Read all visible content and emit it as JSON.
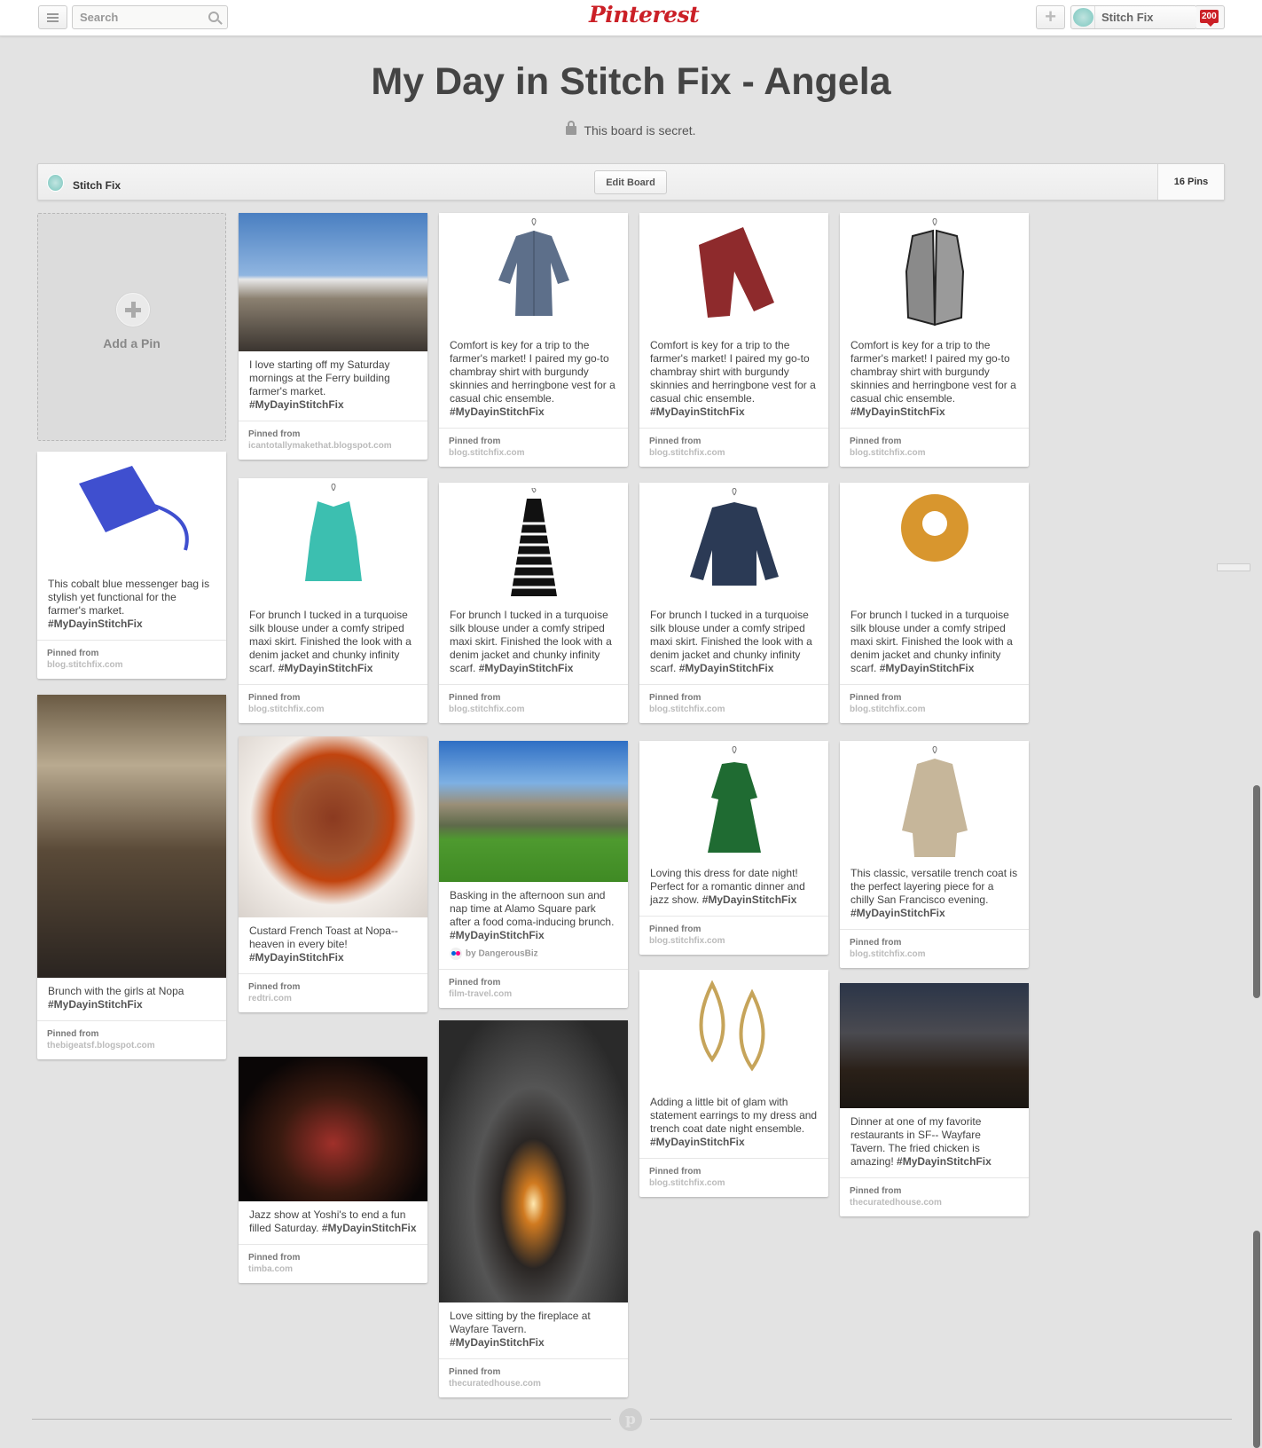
{
  "header": {
    "search_placeholder": "Search",
    "logo": "Pinterest",
    "user_name": "Stitch Fix",
    "notifications": "200",
    "add_icon": "plus-icon",
    "menu_icon": "menu-icon"
  },
  "board": {
    "title": "My Day in Stitch Fix - Angela",
    "secret_note": "This board is secret.",
    "owner": "Stitch Fix",
    "edit_label": "Edit Board",
    "pin_count": "16 Pins",
    "add_pin_label": "Add a Pin"
  },
  "pin_label": "Pinned from",
  "pins": [
    {
      "text": "I love starting off my Saturday mornings at the Ferry building farmer's market.",
      "tag": "#MyDayinStitchFix",
      "source": "icantotallymakethat.blogspot.com"
    },
    {
      "text": "Comfort is key for a trip to the farmer's market! I paired my go-to chambray shirt with burgundy skinnies and herringbone vest for a casual chic ensemble.",
      "tag": "#MyDayinStitchFix",
      "source": "blog.stitchfix.com"
    },
    {
      "text": "Comfort is key for a trip to the farmer's market! I paired my go-to chambray shirt with burgundy skinnies and herringbone vest for a casual chic ensemble.",
      "tag": "#MyDayinStitchFix",
      "source": "blog.stitchfix.com"
    },
    {
      "text": "Comfort is key for a trip to the farmer's market! I paired my go-to chambray shirt with burgundy skinnies and herringbone vest for a casual chic ensemble.",
      "tag": "#MyDayinStitchFix",
      "source": "blog.stitchfix.com"
    },
    {
      "text": "This cobalt blue messenger bag is stylish yet functional for the farmer's market.",
      "tag": "#MyDayinStitchFix",
      "source": "blog.stitchfix.com"
    },
    {
      "text": "For brunch I tucked in a turquoise silk blouse under a comfy striped maxi skirt. Finished the look with a denim jacket and chunky infinity scarf.",
      "tag": "#MyDayinStitchFix",
      "source": "blog.stitchfix.com"
    },
    {
      "text": "For brunch I tucked in a turquoise silk blouse under a comfy striped maxi skirt. Finished the look with a denim jacket and chunky infinity scarf.",
      "tag": "#MyDayinStitchFix",
      "source": "blog.stitchfix.com"
    },
    {
      "text": "For brunch I tucked in a turquoise silk blouse under a comfy striped maxi skirt. Finished the look with a denim jacket and chunky infinity scarf.",
      "tag": "#MyDayinStitchFix",
      "source": "blog.stitchfix.com"
    },
    {
      "text": "For brunch I tucked in a turquoise silk blouse under a comfy striped maxi skirt. Finished the look with a denim jacket and chunky infinity scarf.",
      "tag": "#MyDayinStitchFix",
      "source": "blog.stitchfix.com"
    },
    {
      "text": "Brunch with the girls at Nopa",
      "tag": "#MyDayinStitchFix",
      "source": "thebigeatsf.blogspot.com"
    },
    {
      "text": "Custard French Toast at Nopa--heaven in every bite!",
      "tag": "#MyDayinStitchFix",
      "source": "redtri.com"
    },
    {
      "text": "Basking in the afternoon sun and nap time at Alamo Square park after a food coma-inducing brunch.",
      "tag": "#MyDayinStitchFix",
      "attribution": "by DangerousBiz",
      "source": "film-travel.com"
    },
    {
      "text": "Loving this dress for date night! Perfect for a romantic dinner and jazz show.",
      "tag": "#MyDayinStitchFix",
      "source": "blog.stitchfix.com"
    },
    {
      "text": "This classic, versatile trench coat is the perfect layering piece for a chilly San Francisco evening.",
      "tag": "#MyDayinStitchFix",
      "source": "blog.stitchfix.com"
    },
    {
      "text": "Jazz show at Yoshi's to end a fun filled Saturday.",
      "tag": "#MyDayinStitchFix",
      "source": "timba.com"
    },
    {
      "text": "Love sitting by the fireplace at Wayfare Tavern.",
      "tag": "#MyDayinStitchFix",
      "source": "thecuratedhouse.com"
    },
    {
      "text": "Adding a little bit of glam with statement earrings to my dress and trench coat date night ensemble.",
      "tag": "#MyDayinStitchFix",
      "source": "blog.stitchfix.com"
    },
    {
      "text": "Dinner at one of my favorite restaurants in SF-- Wayfare Tavern. The fried chicken is amazing!",
      "tag": "#MyDayinStitchFix",
      "source": "thecuratedhouse.com"
    }
  ],
  "footer": {
    "logo": "p"
  }
}
